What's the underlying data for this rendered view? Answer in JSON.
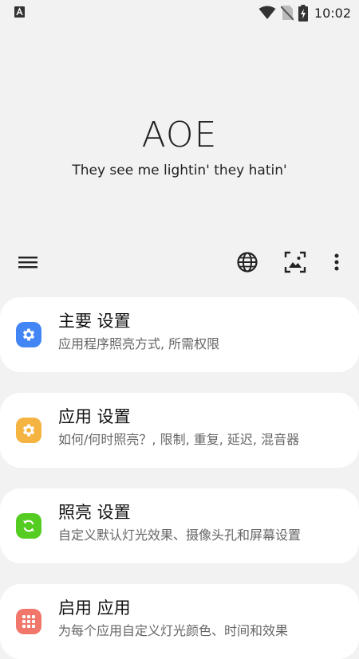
{
  "status_bar": {
    "time": "10:02",
    "left_icon": "a-notification-icon",
    "right_icons": [
      "wifi-icon",
      "no-sim-icon",
      "battery-charging-icon"
    ]
  },
  "header": {
    "title": "AOE",
    "subtitle": "They see me lightin' they hatin'"
  },
  "toolbar": {
    "left_icon": "menu-icon",
    "right_icons": [
      "globe-icon",
      "image-frame-icon",
      "more-vert-icon"
    ]
  },
  "cards": [
    {
      "title": "主要 设置",
      "description": "应用程序照亮方式, 所需权限",
      "icon": "gear-icon",
      "color": "#4285f4"
    },
    {
      "title": "应用 设置",
      "description": "如何/何时照亮？, 限制, 重复, 延迟, 混音器",
      "icon": "gear-icon",
      "color": "#f5b342"
    },
    {
      "title": "照亮 设置",
      "description": "自定义默认灯光效果、摄像头孔和屏幕设置",
      "icon": "refresh-icon",
      "color": "#55cc22"
    },
    {
      "title": "启用 应用",
      "description": "为每个应用自定义灯光颜色、时间和效果",
      "icon": "apps-grid-icon",
      "color": "#f2776b"
    }
  ]
}
